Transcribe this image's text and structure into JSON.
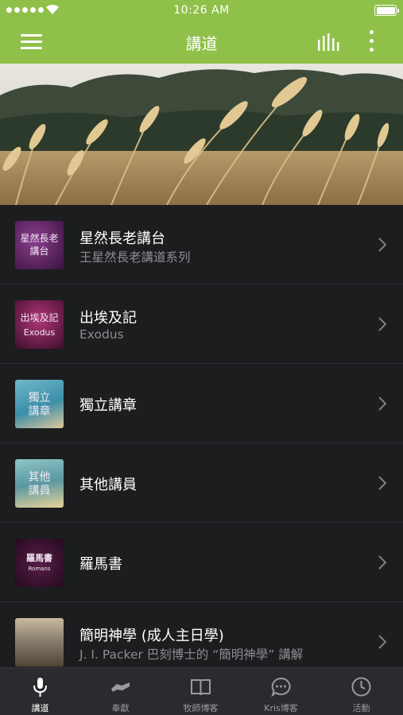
{
  "status_bar": {
    "time": "10:26 AM"
  },
  "nav": {
    "title": "講道"
  },
  "list": [
    {
      "title": "星然長老講台",
      "subtitle": "王星然長老講道系列",
      "thumb_lines": [
        "星然長老",
        "講台"
      ]
    },
    {
      "title": "出埃及記",
      "subtitle": "Exodus",
      "thumb_lines": [
        "出埃及記",
        "Exodus"
      ]
    },
    {
      "title": "獨立講章",
      "subtitle": "",
      "thumb_lines": [
        "獨立",
        "講章"
      ]
    },
    {
      "title": "其他講員",
      "subtitle": "",
      "thumb_lines": [
        "其他",
        "講員"
      ]
    },
    {
      "title": "羅馬書",
      "subtitle": "",
      "thumb_lines": [
        "羅馬書",
        "Romans"
      ]
    },
    {
      "title": "簡明神學 (成人主日學)",
      "subtitle": "J. I. Packer 巴刻博士的 “簡明神學” 講解",
      "thumb_lines": []
    }
  ],
  "tabs": [
    {
      "label": "講道",
      "icon": "microphone-icon"
    },
    {
      "label": "奉獻",
      "icon": "handshake-icon"
    },
    {
      "label": "牧師博客",
      "icon": "book-icon"
    },
    {
      "label": "Kris博客",
      "icon": "chat-bubble-icon"
    },
    {
      "label": "活動",
      "icon": "clock-icon"
    }
  ],
  "colors": {
    "header": "#8fc04a",
    "background": "#1c1d1f",
    "tabbar": "#2a2b2e"
  }
}
